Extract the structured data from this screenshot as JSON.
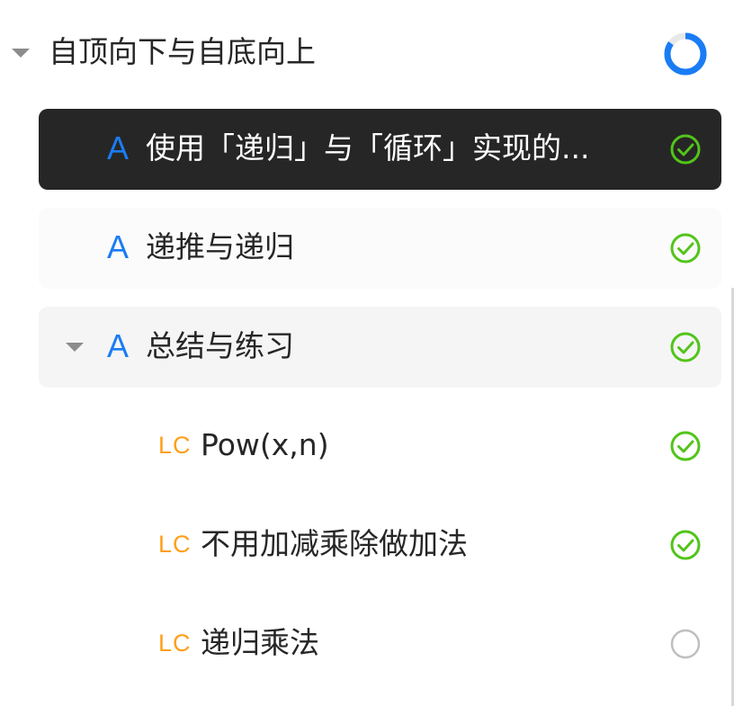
{
  "chapter": {
    "title": "自顶向下与自底向上",
    "progress": 0.85,
    "progress_color": "#1a7cf5",
    "progress_track_color": "#e8e8e8"
  },
  "items": [
    {
      "icon": "article-icon",
      "icon_text": "A",
      "label": "使用「递归」与「循环」实现的...",
      "status": "completed",
      "state": "selected"
    },
    {
      "icon": "article-icon",
      "icon_text": "A",
      "label": "递推与递归",
      "status": "completed",
      "state": "normal"
    },
    {
      "icon": "article-icon",
      "icon_text": "A",
      "label": "总结与练习",
      "status": "completed",
      "state": "expanded"
    },
    {
      "icon": "leetcode-icon",
      "icon_text": "LC",
      "label": "Pow(x,n)",
      "status": "completed",
      "state": "normal"
    },
    {
      "icon": "leetcode-icon",
      "icon_text": "LC",
      "label": "不用加减乘除做加法",
      "status": "completed",
      "state": "normal"
    },
    {
      "icon": "leetcode-icon",
      "icon_text": "LC",
      "label": "递归乘法",
      "status": "not-started",
      "state": "normal"
    }
  ],
  "colors": {
    "completed": "#52c41a",
    "not_started": "#bfbfbf",
    "article_icon": "#1a7cf5",
    "leetcode_icon": "#ff9f1a",
    "selected_bg": "#262626"
  }
}
